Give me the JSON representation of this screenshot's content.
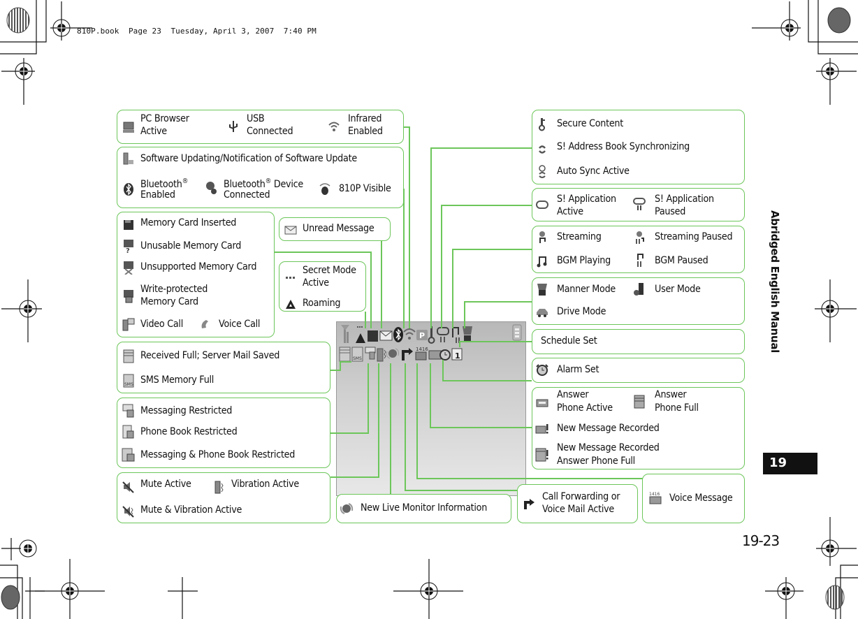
{
  "print_header": "810P.book  Page 23  Tuesday, April 3, 2007  7:40 PM",
  "side_tab": {
    "title": "Abridged English Manual",
    "chapter": "19"
  },
  "page_number": "19-23",
  "accent_color": "#6cc65a",
  "groups": {
    "connectivity": {
      "pc_browser": {
        "icon": "pc-icon",
        "label1": "PC Browser",
        "label2": "Active"
      },
      "usb": {
        "icon": "usb-icon",
        "label1": "USB",
        "label2": "Connected"
      },
      "infrared": {
        "icon": "infrared-icon",
        "label1": "Infrared",
        "label2": "Enabled"
      }
    },
    "bluetooth": {
      "software_update": {
        "icon": "software-update-icon",
        "label": "Software Updating/Notification of Software Update"
      },
      "bt_enabled": {
        "icon": "bluetooth-icon",
        "label1": "Bluetooth",
        "sup": "®",
        "label2": "Enabled"
      },
      "bt_device": {
        "icon": "bluetooth-device-icon",
        "label1": "Bluetooth",
        "sup": "®",
        "label1b": " Device",
        "label2": "Connected"
      },
      "visible": {
        "icon": "bluetooth-visible-icon",
        "label": "810P Visible"
      }
    },
    "memory_card": {
      "inserted": {
        "icon": "memory-card-icon",
        "label": "Memory Card Inserted"
      },
      "unusable": {
        "icon": "memory-card-unusable-icon",
        "label": "Unusable Memory Card"
      },
      "unsupported": {
        "icon": "memory-card-unsupported-icon",
        "label": "Unsupported Memory Card"
      },
      "write_protected": {
        "icon": "memory-card-locked-icon",
        "label1": "Write-protected",
        "label2": "Memory Card"
      },
      "video_call": {
        "icon": "video-call-icon",
        "label": "Video Call"
      },
      "voice_call": {
        "icon": "voice-call-icon",
        "label": "Voice Call"
      }
    },
    "unread": {
      "icon": "envelope-icon",
      "label": "Unread Message"
    },
    "secret": {
      "secret_mode": {
        "icon": "secret-mode-icon",
        "label1": "Secret Mode",
        "label2": "Active"
      },
      "roaming": {
        "icon": "roaming-icon",
        "label": "Roaming"
      }
    },
    "mail_full": {
      "received_full": {
        "icon": "mail-full-icon",
        "label": "Received Full; Server Mail Saved"
      },
      "sms_full": {
        "icon": "sms-full-icon",
        "label": "SMS Memory Full"
      }
    },
    "restricted": {
      "messaging": {
        "icon": "messaging-lock-icon",
        "label": "Messaging Restricted"
      },
      "phonebook": {
        "icon": "phonebook-lock-icon",
        "label": "Phone Book Restricted"
      },
      "both": {
        "icon": "messaging-phonebook-lock-icon",
        "label": "Messaging & Phone Book Restricted"
      }
    },
    "sound": {
      "mute": {
        "icon": "mute-icon",
        "label": "Mute Active"
      },
      "vibration": {
        "icon": "vibration-icon",
        "label": "Vibration Active"
      },
      "mute_vibration": {
        "icon": "mute-vibration-icon",
        "label": "Mute & Vibration Active"
      }
    },
    "live_monitor": {
      "icon": "live-monitor-icon",
      "label": "New Live Monitor Information"
    },
    "call_forwarding": {
      "icon": "call-forward-icon",
      "label1": "Call Forwarding or",
      "label2": "Voice Mail Active"
    },
    "voice_message": {
      "icon": "voice-message-icon",
      "label": "Voice Message"
    },
    "secure": {
      "secure_content": {
        "icon": "key-icon",
        "label": "Secure Content"
      },
      "address_sync": {
        "icon": "sync-icon",
        "label": "S! Address Book Synchronizing"
      },
      "auto_sync": {
        "icon": "auto-sync-icon",
        "label": "Auto Sync Active"
      }
    },
    "app": {
      "active": {
        "icon": "gamepad-icon",
        "label1": "S! Application",
        "label2": "Active"
      },
      "paused": {
        "icon": "gamepad-paused-icon",
        "label1": "S! Application",
        "label2": "Paused"
      }
    },
    "media": {
      "streaming": {
        "icon": "streaming-icon",
        "label": "Streaming"
      },
      "streaming_paused": {
        "icon": "streaming-paused-icon",
        "label": "Streaming Paused"
      },
      "bgm_playing": {
        "icon": "music-note-icon",
        "label": "BGM Playing"
      },
      "bgm_paused": {
        "icon": "music-paused-icon",
        "label": "BGM Paused"
      }
    },
    "modes": {
      "manner": {
        "icon": "manner-mode-icon",
        "label": "Manner Mode"
      },
      "user": {
        "icon": "user-mode-icon",
        "label": "User Mode"
      },
      "drive": {
        "icon": "car-icon",
        "label": "Drive Mode"
      }
    },
    "schedule": {
      "label": "Schedule Set"
    },
    "alarm": {
      "icon": "alarm-clock-icon",
      "label": "Alarm Set"
    },
    "answer_phone": {
      "active": {
        "icon": "answer-phone-icon",
        "label1": "Answer",
        "label2": "Phone Active"
      },
      "full": {
        "icon": "answer-phone-full-icon",
        "label1": "Answer",
        "label2": "Phone Full"
      },
      "new_recorded": {
        "icon": "answer-phone-new-icon",
        "label": "New Message Recorded"
      },
      "new_recorded_full": {
        "icon": "answer-phone-new-full-icon",
        "label1": "New Message Recorded",
        "label2": "Answer Phone Full"
      }
    }
  },
  "phone_screen": {
    "row1": [
      "signal-icon",
      "roaming-icon",
      "memory-card-icon",
      "envelope-icon",
      "bluetooth-icon",
      "infrared-icon",
      "pc-p-icon",
      "key-icon",
      "gamepad-paused-icon",
      "music-paused-icon",
      "manner-mode-icon",
      "battery-icon"
    ],
    "row2": [
      "mail-full-icon",
      "sms-full-icon",
      "messaging-lock-icon",
      "vibration-icon",
      "live-monitor-icon",
      "call-forward-icon",
      "voice-message-icon",
      "answer-phone-icon",
      "alarm-clock-icon",
      "calendar-icon"
    ],
    "voice_msg_digits": "1416",
    "calendar_digit": "1"
  }
}
